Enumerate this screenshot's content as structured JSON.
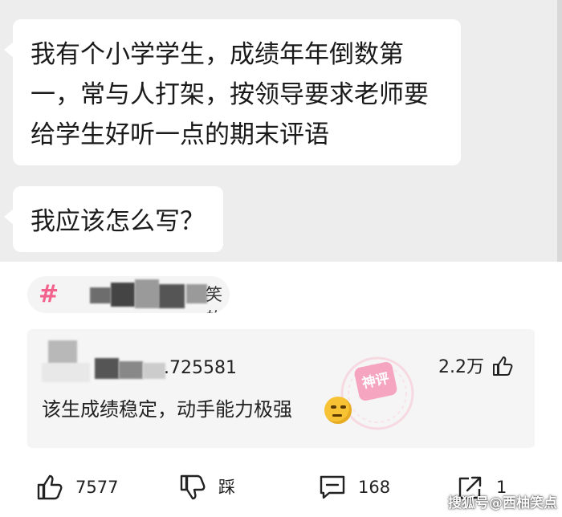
{
  "chat": {
    "bubbles": [
      {
        "lines": [
          "我有个小学学生，成绩年年倒数第",
          "一，常与人打架，按领导要求老师要",
          "给学生好听一点的期末评语"
        ]
      },
      {
        "lines": [
          "我应该怎么写？"
        ]
      }
    ]
  },
  "hashtag": {
    "symbol": "#",
    "visible_suffix": "笑的"
  },
  "comment": {
    "user_id_partial": ".725581",
    "likes": "2.2万",
    "text": "该生成绩稳定，动手能力极强",
    "stamp_label": "神评"
  },
  "actions": {
    "like_count": "7577",
    "dislike_label": "踩",
    "comment_count": "168",
    "share_count": "1"
  },
  "watermark": "搜狐号@西柚笑点",
  "colors": {
    "chat_bg": "#ededed",
    "bubble_bg": "#ffffff",
    "hashtag_pink": "#f2628c",
    "card_bg": "#f5f5f5"
  }
}
